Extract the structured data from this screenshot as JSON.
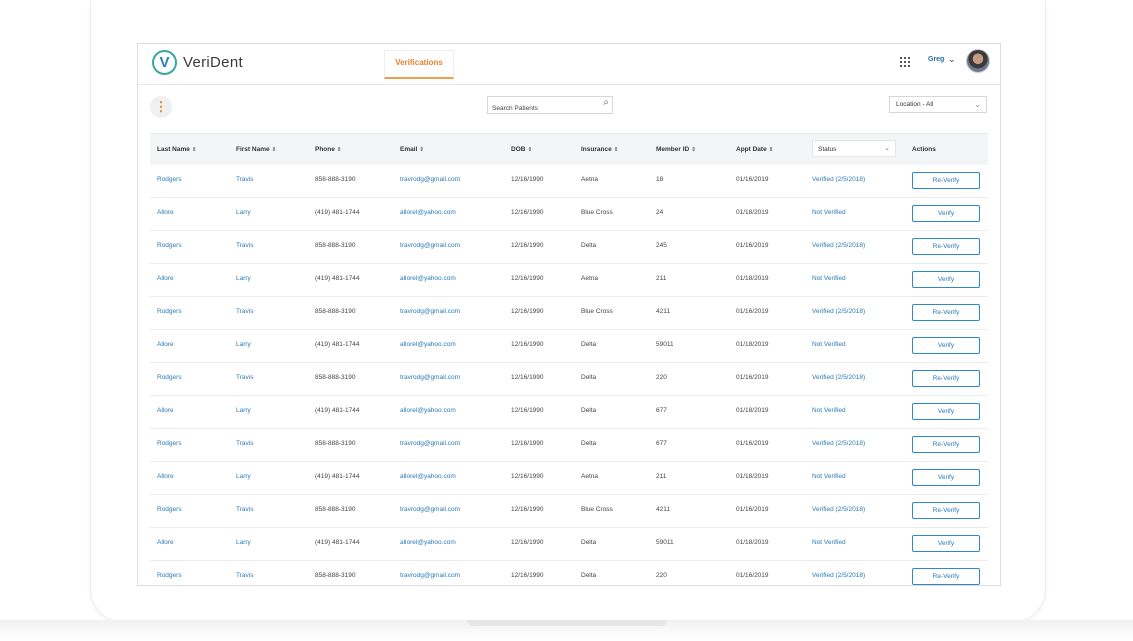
{
  "brand": {
    "name": "VeriDent",
    "logo_letter": "V"
  },
  "nav": {
    "active_tab": "Verifications"
  },
  "user": {
    "name": "Greg",
    "chevron": "⌄"
  },
  "toolbar": {
    "menu_glyph": "⋮",
    "search_placeholder": "Search Patients",
    "location_label": "Location - All",
    "location_chevron": "⌄"
  },
  "colors": {
    "accent": "#e8822f",
    "link": "#2a7ab8",
    "button_border": "#3288c2"
  },
  "table": {
    "sort_glyph": "⇕",
    "columns": [
      "Last Name",
      "First Name",
      "Phone",
      "Email",
      "DOB",
      "Insurance",
      "Member ID",
      "Appt Date",
      "Status",
      "Actions"
    ],
    "rows": [
      {
        "last": "Rodgers",
        "first": "Travis",
        "phone": "858-888-3190",
        "email": "travrodg@gmail.com",
        "dob": "12/16/1990",
        "insurance": "Aetna",
        "member_id": "18",
        "appt": "01/16/2019",
        "status": "Verified (2/5/2018)",
        "action": "Re-Verify"
      },
      {
        "last": "Allore",
        "first": "Larry",
        "phone": "(419) 481-1744",
        "email": "allorel@yahoo.com",
        "dob": "12/16/1990",
        "insurance": "Blue Cross",
        "member_id": "24",
        "appt": "01/18/2019",
        "status": "Not Verified",
        "action": "Verify"
      },
      {
        "last": "Rodgers",
        "first": "Travis",
        "phone": "858-888-3190",
        "email": "travrodg@gmail.com",
        "dob": "12/16/1990",
        "insurance": "Delta",
        "member_id": "245",
        "appt": "01/16/2019",
        "status": "Verified (2/5/2018)",
        "action": "Re-Verify"
      },
      {
        "last": "Allore",
        "first": "Larry",
        "phone": "(419) 481-1744",
        "email": "allorel@yahoo.com",
        "dob": "12/16/1990",
        "insurance": "Aetna",
        "member_id": "211",
        "appt": "01/18/2019",
        "status": "Not Verified",
        "action": "Verify"
      },
      {
        "last": "Rodgers",
        "first": "Travis",
        "phone": "858-888-3190",
        "email": "travrodg@gmail.com",
        "dob": "12/16/1990",
        "insurance": "Blue Cross",
        "member_id": "4211",
        "appt": "01/16/2019",
        "status": "Verified (2/5/2018)",
        "action": "Re-Verify"
      },
      {
        "last": "Allore",
        "first": "Larry",
        "phone": "(419) 481-1744",
        "email": "allorel@yahoo.com",
        "dob": "12/16/1990",
        "insurance": "Delta",
        "member_id": "59011",
        "appt": "01/18/2019",
        "status": "Not Verified",
        "action": "Verify"
      },
      {
        "last": "Rodgers",
        "first": "Travis",
        "phone": "858-888-3190",
        "email": "travrodg@gmail.com",
        "dob": "12/16/1990",
        "insurance": "Delta",
        "member_id": "220",
        "appt": "01/16/2019",
        "status": "Verified (2/5/2018)",
        "action": "Re-Verify"
      },
      {
        "last": "Allore",
        "first": "Larry",
        "phone": "(419) 481-1744",
        "email": "allorel@yahoo.com",
        "dob": "12/16/1990",
        "insurance": "Delta",
        "member_id": "677",
        "appt": "01/18/2019",
        "status": "Not Verified",
        "action": "Verify"
      },
      {
        "last": "Rodgers",
        "first": "Travis",
        "phone": "858-888-3190",
        "email": "travrodg@gmail.com",
        "dob": "12/16/1990",
        "insurance": "Delta",
        "member_id": "677",
        "appt": "01/16/2019",
        "status": "Verified (2/5/2018)",
        "action": "Re-Verify"
      },
      {
        "last": "Allore",
        "first": "Larry",
        "phone": "(419) 481-1744",
        "email": "allorel@yahoo.com",
        "dob": "12/16/1990",
        "insurance": "Aetna",
        "member_id": "211",
        "appt": "01/18/2019",
        "status": "Not Verified",
        "action": "Verify"
      },
      {
        "last": "Rodgers",
        "first": "Travis",
        "phone": "858-888-3190",
        "email": "travrodg@gmail.com",
        "dob": "12/16/1990",
        "insurance": "Blue Cross",
        "member_id": "4211",
        "appt": "01/16/2019",
        "status": "Verified (2/5/2018)",
        "action": "Re-Verify"
      },
      {
        "last": "Allore",
        "first": "Larry",
        "phone": "(419) 481-1744",
        "email": "allorel@yahoo.com",
        "dob": "12/16/1990",
        "insurance": "Delta",
        "member_id": "59011",
        "appt": "01/18/2019",
        "status": "Not Verified",
        "action": "Verify"
      },
      {
        "last": "Rodgers",
        "first": "Travis",
        "phone": "858-888-3190",
        "email": "travrodg@gmail.com",
        "dob": "12/16/1990",
        "insurance": "Delta",
        "member_id": "220",
        "appt": "01/16/2019",
        "status": "Verified (2/5/2018)",
        "action": "Re-Verify"
      }
    ]
  }
}
